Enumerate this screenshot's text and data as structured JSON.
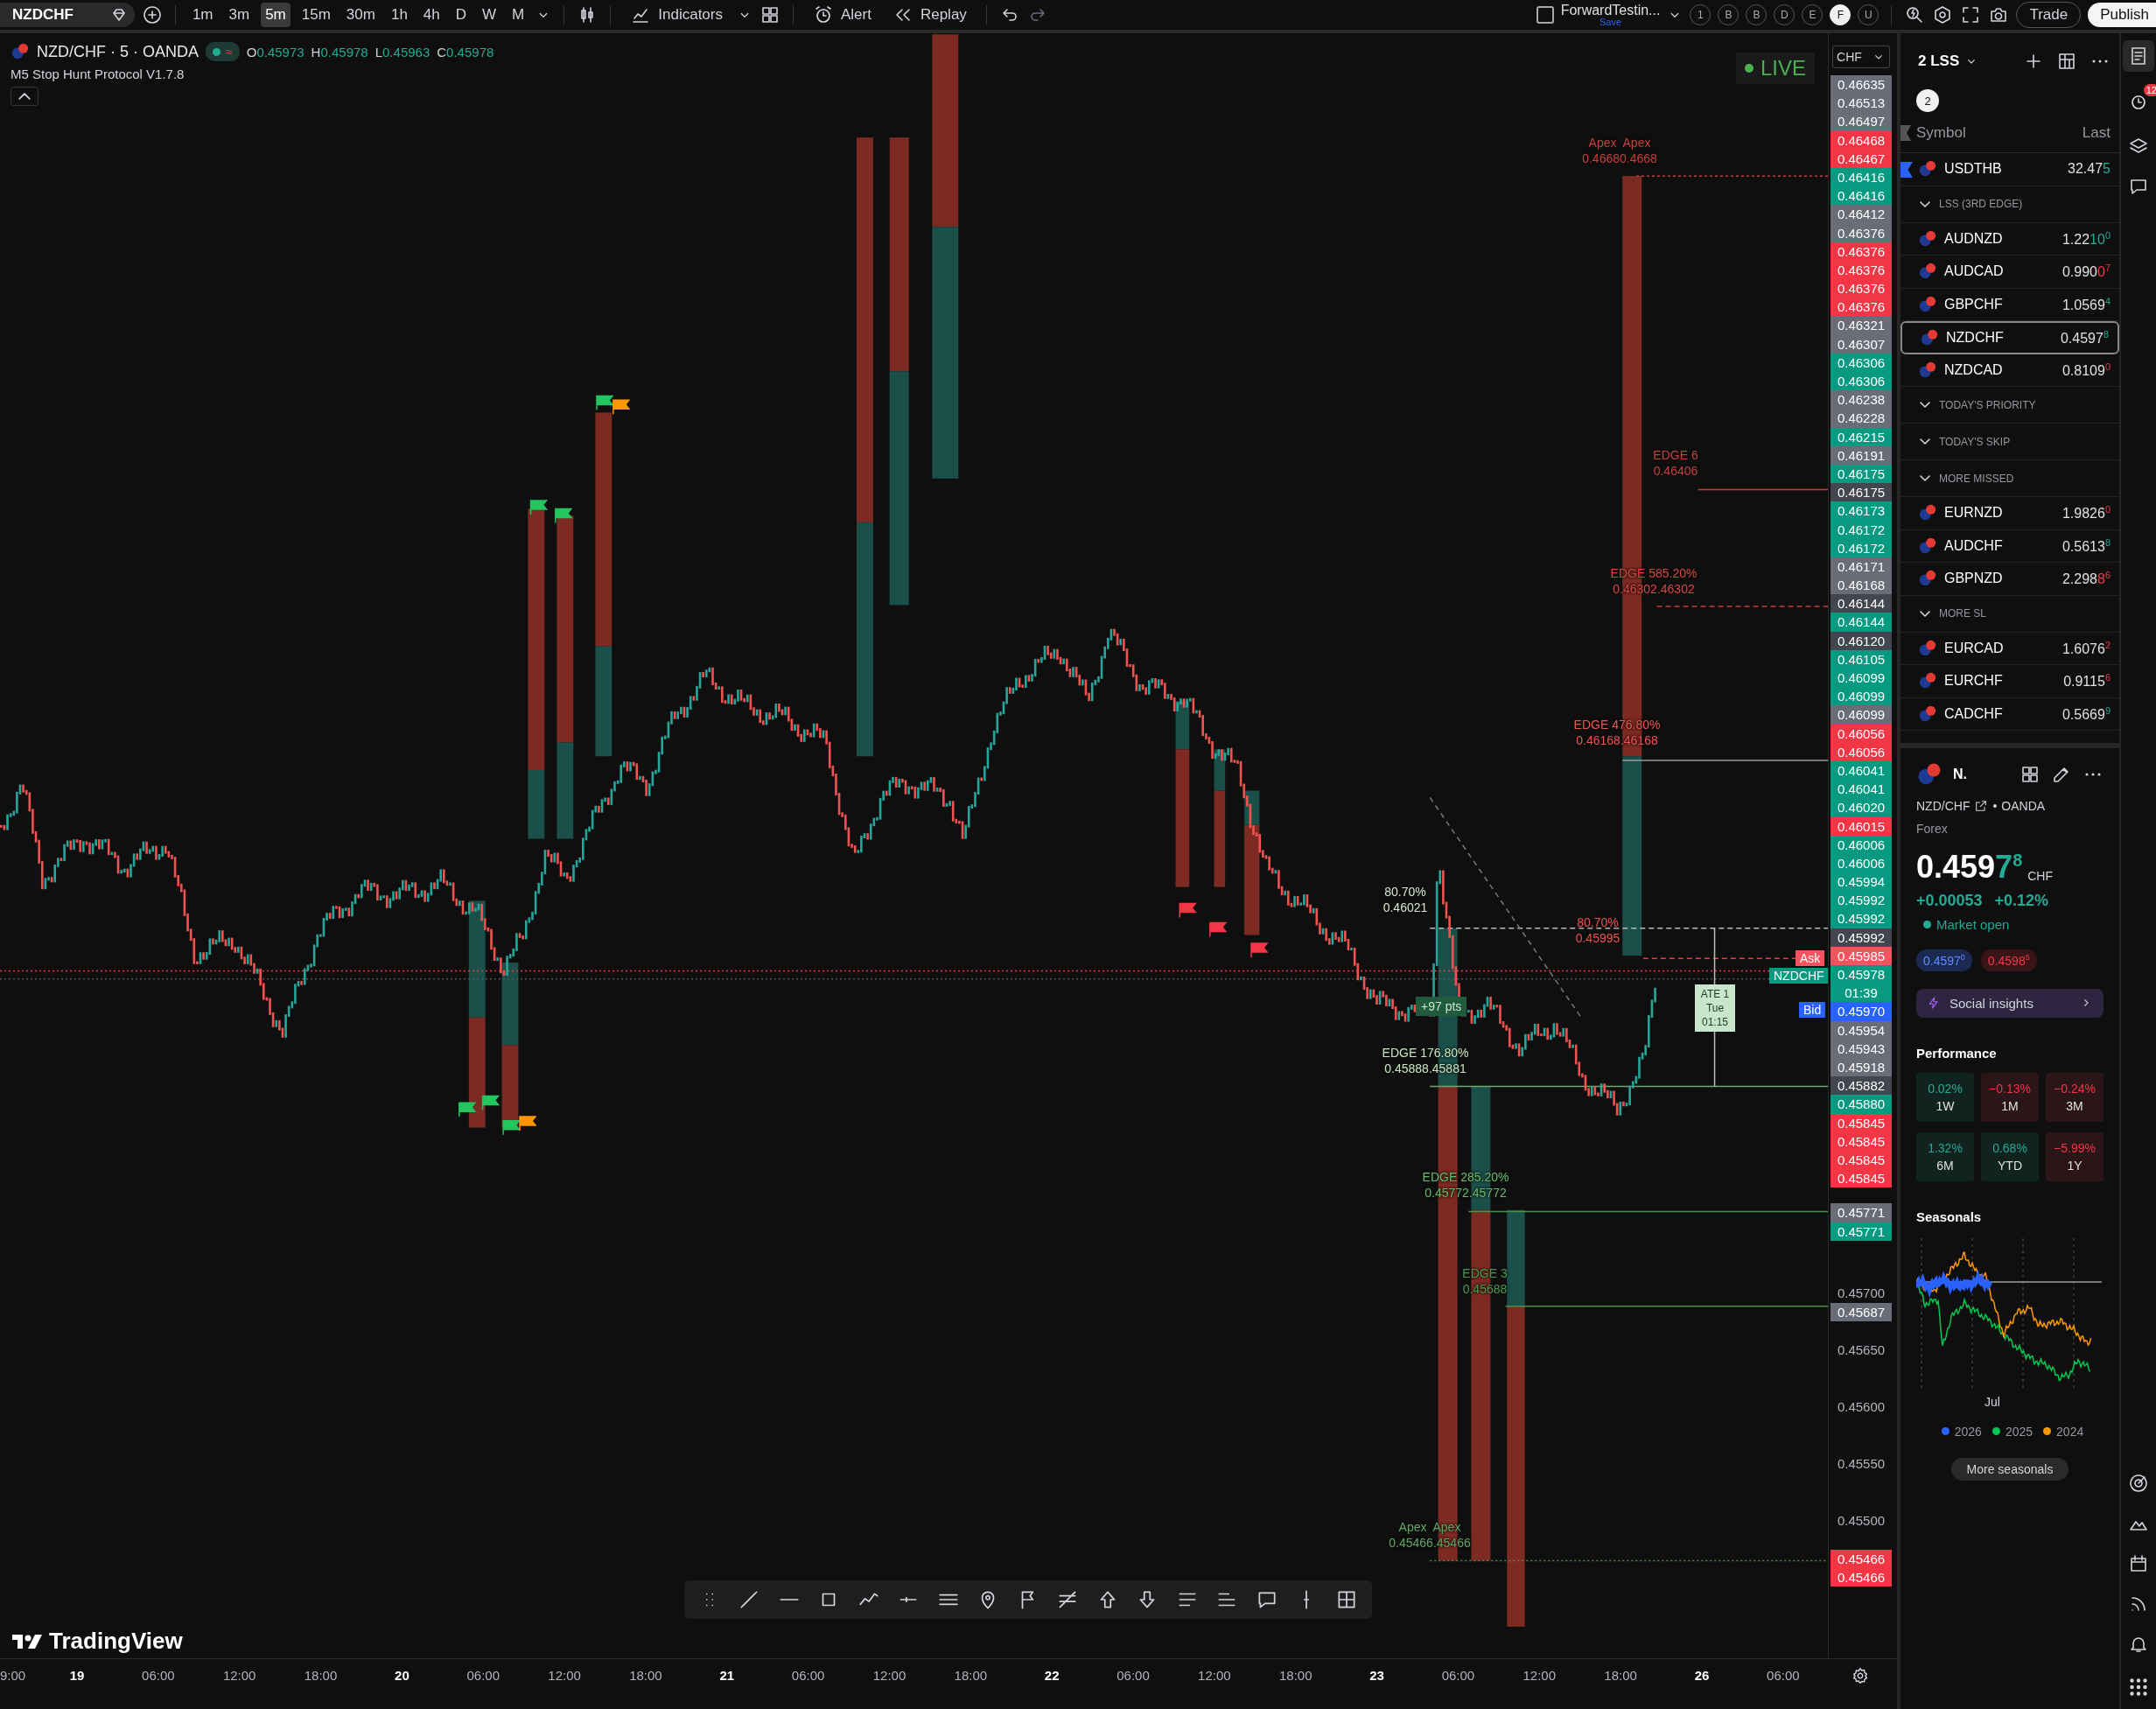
{
  "top_bar": {
    "symbol": "NZDCHF",
    "intervals": [
      {
        "label": "1m",
        "selected": false
      },
      {
        "label": "3m",
        "selected": false
      },
      {
        "label": "5m",
        "selected": true
      },
      {
        "label": "15m",
        "selected": false
      },
      {
        "label": "30m",
        "selected": false
      },
      {
        "label": "1h",
        "selected": false
      },
      {
        "label": "4h",
        "selected": false
      },
      {
        "label": "D",
        "selected": false
      },
      {
        "label": "W",
        "selected": false
      },
      {
        "label": "M",
        "selected": false
      }
    ],
    "indicators": "Indicators",
    "alert": "Alert",
    "replay": "Replay",
    "layout_checked": false,
    "layout_name": "ForwardTestin...",
    "layout_status": "Save",
    "quick_buttons": [
      {
        "label": "1",
        "selected": false
      },
      {
        "label": "B",
        "selected": false
      },
      {
        "label": "B",
        "selected": false
      },
      {
        "label": "D",
        "selected": false
      },
      {
        "label": "E",
        "selected": false
      },
      {
        "label": "F",
        "selected": true
      },
      {
        "label": "U",
        "selected": false
      }
    ],
    "trade": "Trade",
    "publish": "Publish"
  },
  "chart": {
    "legend": {
      "title": "NZD/CHF · 5 · OANDA",
      "status_glyph": "≈",
      "ohlc": [
        {
          "key": "O",
          "value": "0.45973"
        },
        {
          "key": "H",
          "value": "0.45978"
        },
        {
          "key": "L",
          "value": "0.45963"
        },
        {
          "key": "C",
          "value": "0.45978"
        }
      ],
      "indicator": "M5 Stop Hunt Protocol V1.7.8"
    },
    "live": "LIVE",
    "currency": "CHF",
    "annotations": [
      {
        "lines": [
          "Apex  Apex",
          "0.46680.4668"
        ],
        "color": "#c2413b"
      },
      {
        "lines": [
          "EDGE 6",
          "0.46406"
        ],
        "color": "#c2413b"
      },
      {
        "lines": [
          "EDGE 585.20%",
          "0.46302.46302"
        ],
        "color": "#d9463e"
      },
      {
        "lines": [
          "EDGE 476.80%",
          "0.46168.46168"
        ],
        "color": "#ef5350"
      },
      {
        "lines": [
          "80.70%",
          "0.46021"
        ],
        "color": "#d8e6d0"
      },
      {
        "lines": [
          "80.70%",
          "0.45995"
        ],
        "color": "#ef5350"
      },
      {
        "lines": [
          "EDGE 176.80%",
          "0.45888.45881"
        ],
        "color": "#c8e6c0"
      },
      {
        "lines": [
          "EDGE 285.20%",
          "0.45772.45772"
        ],
        "color": "#66bb6a"
      },
      {
        "lines": [
          "EDGE 3",
          "0.45688"
        ],
        "color": "#4a9a4e"
      },
      {
        "lines": [
          "Apex  Apex",
          "0.45466.45466"
        ],
        "color": "#5fa862"
      }
    ],
    "pts_badge": "+97 pts",
    "time_box": [
      "ATE 1",
      "Tue",
      "01:15"
    ],
    "ask_tag": "Ask",
    "symbol_tag": "NZDCHF",
    "bid_tag": "Bid",
    "brand": "TradingView"
  },
  "price_scale": {
    "tags": [
      {
        "text": "0.46635",
        "color": "#6a6d78"
      },
      {
        "text": "0.46513",
        "color": "#6a6d78"
      },
      {
        "text": "0.46497",
        "color": "#6a6d78"
      },
      {
        "text": "0.46468",
        "color": "#f23645"
      },
      {
        "text": "0.46467",
        "color": "#f23645"
      },
      {
        "text": "0.46416",
        "color": "#089981"
      },
      {
        "text": "0.46416",
        "color": "#089981"
      },
      {
        "text": "0.46412",
        "color": "#6a6d78"
      },
      {
        "text": "0.46376",
        "color": "#6a6d78"
      },
      {
        "text": "0.46376",
        "color": "#f23645"
      },
      {
        "text": "0.46376",
        "color": "#f23645"
      },
      {
        "text": "0.46376",
        "color": "#f23645"
      },
      {
        "text": "0.46376",
        "color": "#f23645"
      },
      {
        "text": "0.46321",
        "color": "#6a6d78"
      },
      {
        "text": "0.46307",
        "color": "#6a6d78"
      },
      {
        "text": "0.46306",
        "color": "#089981"
      },
      {
        "text": "0.46306",
        "color": "#089981"
      },
      {
        "text": "0.46238",
        "color": "#6a6d78"
      },
      {
        "text": "0.46228",
        "color": "#6a6d78"
      },
      {
        "text": "0.46215",
        "color": "#089981"
      },
      {
        "text": "0.46191",
        "color": "#6a6d78"
      },
      {
        "text": "0.46175",
        "color": "#089981"
      },
      {
        "text": "0.46175",
        "color": "#44464f"
      },
      {
        "text": "0.46173",
        "color": "#089981"
      },
      {
        "text": "0.46172",
        "color": "#089981"
      },
      {
        "text": "0.46172",
        "color": "#089981"
      },
      {
        "text": "0.46171",
        "color": "#6a6d78"
      },
      {
        "text": "0.46168",
        "color": "#6a6d78"
      },
      {
        "text": "0.46144",
        "color": "#44464f"
      },
      {
        "text": "0.46144",
        "color": "#089981"
      },
      {
        "text": "0.46120",
        "color": "#44464f"
      },
      {
        "text": "0.46105",
        "color": "#089981"
      },
      {
        "text": "0.46099",
        "color": "#089981"
      },
      {
        "text": "0.46099",
        "color": "#089981"
      },
      {
        "text": "0.46099",
        "color": "#6a6d78"
      },
      {
        "text": "0.46056",
        "color": "#f23645"
      },
      {
        "text": "0.46056",
        "color": "#f23645"
      },
      {
        "text": "0.46041",
        "color": "#089981"
      },
      {
        "text": "0.46041",
        "color": "#089981"
      },
      {
        "text": "0.46020",
        "color": "#089981"
      },
      {
        "text": "0.46015",
        "color": "#f23645"
      },
      {
        "text": "0.46006",
        "color": "#089981"
      },
      {
        "text": "0.46006",
        "color": "#089981"
      },
      {
        "text": "0.45994",
        "color": "#089981"
      },
      {
        "text": "0.45992",
        "color": "#089981"
      },
      {
        "text": "0.45992",
        "color": "#089981"
      },
      {
        "text": "0.45992",
        "color": "#44464f"
      },
      {
        "text": "0.45985",
        "color": "#f7525f"
      },
      {
        "text": "0.45978",
        "sub": "01:39",
        "color": "#089981"
      },
      {
        "text": "0.45970",
        "color": "#2962ff"
      },
      {
        "text": "0.45954",
        "color": "#6a6d78"
      },
      {
        "text": "0.45943",
        "color": "#6a6d78"
      },
      {
        "text": "0.45918",
        "color": "#6a6d78"
      },
      {
        "text": "0.45882",
        "color": "#44464f"
      },
      {
        "text": "0.45880",
        "color": "#089981"
      },
      {
        "text": "0.45845",
        "color": "#f23645"
      },
      {
        "text": "0.45845",
        "color": "#f23645"
      },
      {
        "text": "0.45845",
        "color": "#f23645"
      },
      {
        "text": "0.45845",
        "color": "#f23645"
      }
    ],
    "ticks": [
      {
        "text": "0.45771",
        "color": "#6a6d78"
      },
      {
        "text": "0.45771",
        "color": "#089981"
      },
      {
        "text": "0.45700"
      },
      {
        "text": "0.45687",
        "color": "#6a6d78"
      },
      {
        "text": "0.45650"
      },
      {
        "text": "0.45600"
      },
      {
        "text": "0.45550"
      },
      {
        "text": "0.45500"
      },
      {
        "text": "0.45466",
        "color": "#f23645"
      },
      {
        "text": "0.45466",
        "color": "#f23645"
      }
    ]
  },
  "time_axis": [
    {
      "label": "9:00",
      "kind": "time"
    },
    {
      "label": "19",
      "kind": "day"
    },
    {
      "label": "06:00",
      "kind": "time"
    },
    {
      "label": "12:00",
      "kind": "time"
    },
    {
      "label": "18:00",
      "kind": "time"
    },
    {
      "label": "20",
      "kind": "day"
    },
    {
      "label": "06:00",
      "kind": "time"
    },
    {
      "label": "12:00",
      "kind": "time"
    },
    {
      "label": "18:00",
      "kind": "time"
    },
    {
      "label": "21",
      "kind": "day"
    },
    {
      "label": "06:00",
      "kind": "time"
    },
    {
      "label": "12:00",
      "kind": "time"
    },
    {
      "label": "18:00",
      "kind": "time"
    },
    {
      "label": "22",
      "kind": "day"
    },
    {
      "label": "06:00",
      "kind": "time"
    },
    {
      "label": "12:00",
      "kind": "time"
    },
    {
      "label": "18:00",
      "kind": "time"
    },
    {
      "label": "23",
      "kind": "day"
    },
    {
      "label": "06:00",
      "kind": "time"
    },
    {
      "label": "12:00",
      "kind": "time"
    },
    {
      "label": "18:00",
      "kind": "time"
    },
    {
      "label": "26",
      "kind": "day"
    },
    {
      "label": "06:00",
      "kind": "time"
    }
  ],
  "watchlist": {
    "title": "2 LSS",
    "badge": "2",
    "columns": [
      "Symbol",
      "Last"
    ],
    "alert_badge": "12",
    "items": [
      {
        "kind": "symbol",
        "symbol": "USDTHB",
        "price_base": "32.47",
        "price_changed": "5",
        "up": true,
        "selected": false,
        "flagged": true
      },
      {
        "kind": "section",
        "title": "LSS (3RD EDGE)",
        "expanded": true,
        "children": [
          {
            "kind": "symbol",
            "symbol": "AUDNZD",
            "price_base": "1.22",
            "price_changed": "10",
            "price_pip": "0",
            "up": true,
            "selected": false,
            "flagged": false
          },
          {
            "kind": "symbol",
            "symbol": "AUDCAD",
            "price_base": "0.990",
            "price_changed": "0",
            "price_pip": "7",
            "up": false,
            "selected": false,
            "flagged": false
          },
          {
            "kind": "symbol",
            "symbol": "GBPCHF",
            "price_base": "1.0569",
            "price_pip": "4",
            "up": true,
            "selected": false,
            "flagged": false
          },
          {
            "kind": "symbol",
            "symbol": "NZDCHF",
            "price_base": "0.4597",
            "price_pip": "8",
            "up": true,
            "selected": true,
            "flagged": false
          },
          {
            "kind": "symbol",
            "symbol": "NZDCAD",
            "price_base": "0.8109",
            "price_pip": "0",
            "up": false,
            "selected": false,
            "flagged": false
          }
        ]
      },
      {
        "kind": "section",
        "title": "TODAY'S PRIORITY",
        "expanded": true
      },
      {
        "kind": "section",
        "title": "TODAY'S SKIP",
        "expanded": true
      },
      {
        "kind": "section",
        "title": "MORE MISSED",
        "expanded": true,
        "children": [
          {
            "kind": "symbol",
            "symbol": "EURNZD",
            "price_base": "1.9826",
            "price_pip": "0",
            "up": false,
            "selected": false,
            "flagged": false
          },
          {
            "kind": "symbol",
            "symbol": "AUDCHF",
            "price_base": "0.5613",
            "price_pip": "8",
            "up": true,
            "selected": false,
            "flagged": false
          },
          {
            "kind": "symbol",
            "symbol": "GBPNZD",
            "price_base": "2.298",
            "price_changed": "8",
            "price_pip": "6",
            "up": false,
            "selected": false,
            "flagged": false
          }
        ]
      },
      {
        "kind": "section",
        "title": "MORE SL",
        "expanded": true,
        "children": [
          {
            "kind": "symbol",
            "symbol": "EURCAD",
            "price_base": "1.6076",
            "price_pip": "2",
            "up": false,
            "selected": false,
            "flagged": false
          },
          {
            "kind": "symbol",
            "symbol": "EURCHF",
            "price_base": "0.9115",
            "price_pip": "6",
            "up": false,
            "selected": false,
            "flagged": false
          },
          {
            "kind": "symbol",
            "symbol": "CADCHF",
            "price_base": "0.5669",
            "price_pip": "9",
            "up": true,
            "selected": false,
            "flagged": false
          }
        ]
      }
    ]
  },
  "details": {
    "short_name": "N.",
    "pair": "NZD/CHF",
    "exchange": "OANDA",
    "separator": "•",
    "category": "Forex",
    "price_base": "0.459",
    "price_changed": "7",
    "price_pip": "8",
    "currency": "CHF",
    "up": true,
    "change": "+0.00053",
    "change_percent": "+0.12%",
    "market_open": true,
    "market_status": "Market open",
    "bid": {
      "base": "0.4597",
      "pip": "0"
    },
    "ask": {
      "base": "0.4598",
      "pip": "5"
    },
    "social": "Social insights",
    "performance_title": "Performance",
    "performance": [
      {
        "value": "0.02%",
        "period": "1W",
        "up": true
      },
      {
        "value": "−0.13%",
        "period": "1M",
        "up": false
      },
      {
        "value": "−0.24%",
        "period": "3M",
        "up": false
      },
      {
        "value": "1.32%",
        "period": "6M",
        "up": true
      },
      {
        "value": "0.68%",
        "period": "YTD",
        "up": true
      },
      {
        "value": "−5.99%",
        "period": "1Y",
        "up": false
      }
    ],
    "seasonals_title": "Seasonals",
    "seasonals_month": "Jul",
    "seasonals_legend": [
      {
        "label": "2026",
        "color": "#2962ff"
      },
      {
        "label": "2025",
        "color": "#00c853"
      },
      {
        "label": "2024",
        "color": "#ff9800"
      }
    ],
    "more_seasonals": "More seasonals"
  }
}
